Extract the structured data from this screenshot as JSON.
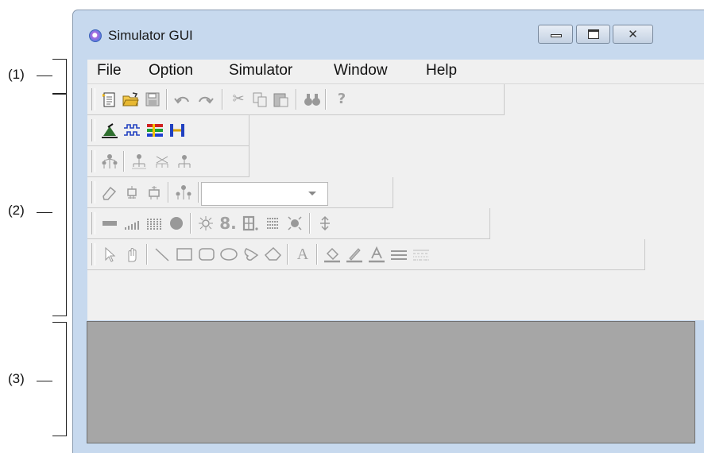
{
  "window": {
    "title": "Simulator GUI"
  },
  "callouts": [
    "(1)",
    "(2)",
    "(3)"
  ],
  "menu": [
    "File",
    "Option",
    "Simulator",
    "Window",
    "Help"
  ],
  "toolbars": {
    "standard": [
      "new-file",
      "open-folder",
      "save",
      "undo",
      "redo",
      "cut",
      "copy",
      "paste",
      "find",
      "help"
    ],
    "simulator": [
      "simulator-run",
      "signal-wave",
      "color-bars",
      "pin-connect"
    ],
    "hierarchy": [
      "hierarchy",
      "hierarchy-down",
      "hierarchy-cross",
      "hierarchy-reset"
    ],
    "parts": [
      "eraser",
      "part-a",
      "part-b",
      "hierarchy-select",
      "parts-combo"
    ],
    "components": [
      "led-bar",
      "level-meter",
      "matrix-led",
      "lamp",
      "sun-light",
      "7seg",
      "14seg",
      "dot-matrix",
      "buzzer",
      "resize-vertical"
    ],
    "drawing": [
      "arrow-select",
      "hand",
      "line",
      "rectangle",
      "rounded-rectangle",
      "ellipse",
      "freeform",
      "polygon",
      "text",
      "fill-color",
      "line-color",
      "text-color",
      "line-width",
      "line-style"
    ]
  }
}
